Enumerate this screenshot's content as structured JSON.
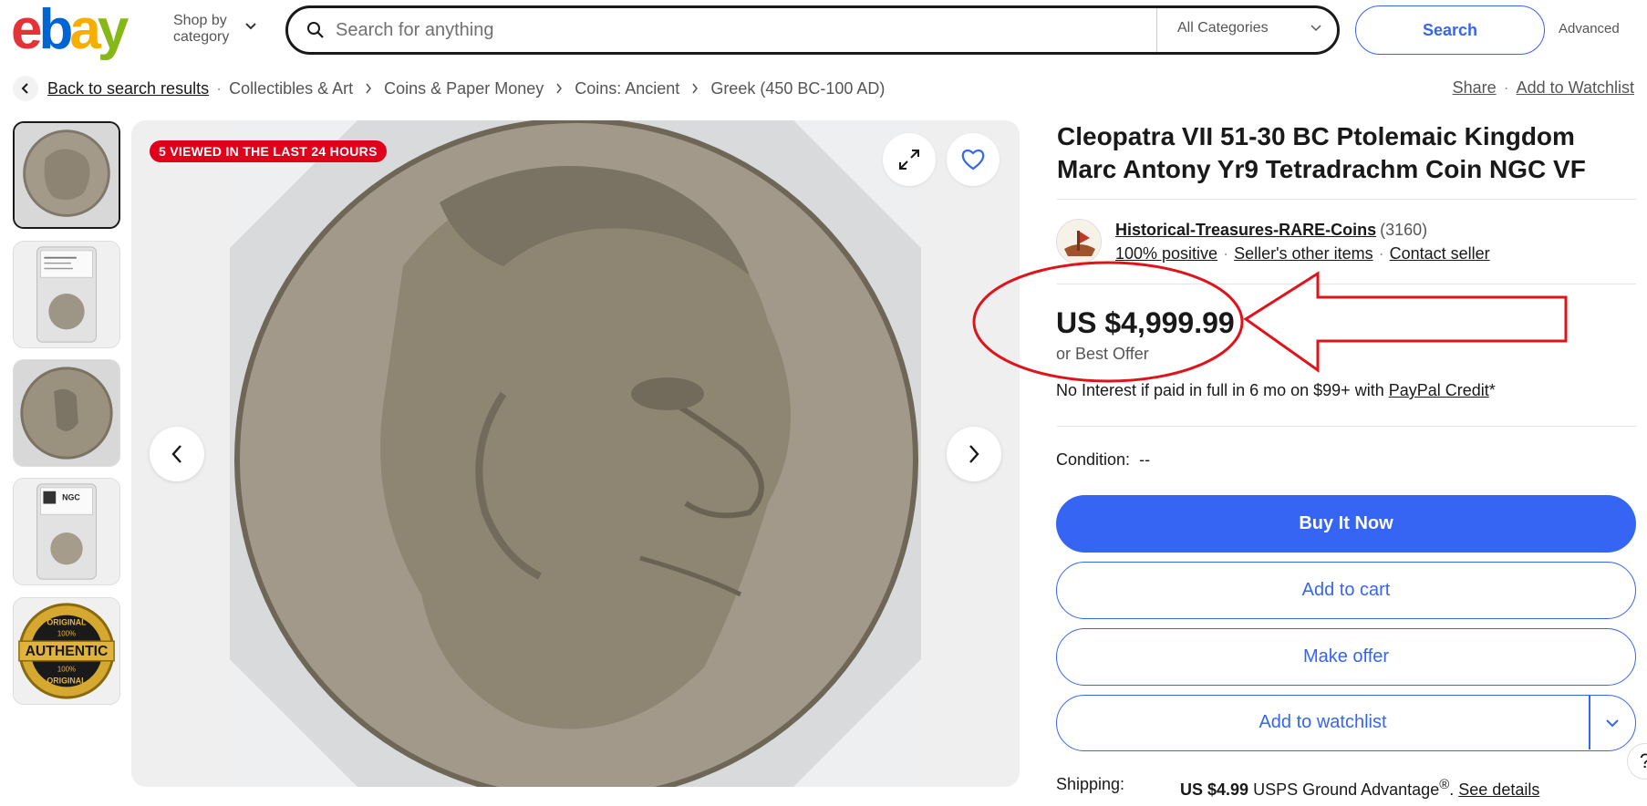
{
  "header": {
    "logo": {
      "e": "e",
      "b": "b",
      "a": "a",
      "y": "y"
    },
    "shop_by_line1": "Shop by",
    "shop_by_line2": "category",
    "search_placeholder": "Search for anything",
    "category": "All Categories",
    "search_button": "Search",
    "advanced": "Advanced"
  },
  "breadcrumb": {
    "back": "Back to search results",
    "items": [
      "Collectibles & Art",
      "Coins & Paper Money",
      "Coins: Ancient",
      "Greek (450 BC-100 AD)"
    ],
    "share": "Share",
    "watchlist": "Add to Watchlist"
  },
  "gallery": {
    "badge": "5 VIEWED IN THE LAST 24 HOURS",
    "thumb_authentic": {
      "top": "ORIGINAL",
      "pct": "100%",
      "main": "AUTHENTIC",
      "pct2": "100%",
      "bottom": "ORIGINAL"
    },
    "thumb_label": "NGC"
  },
  "listing": {
    "title": "Cleopatra VII 51-30 BC Ptolemaic Kingdom Marc Antony Yr9 Tetradrachm Coin NGC VF",
    "seller": {
      "name": "Historical-Treasures-RARE-Coins",
      "feedback": "(3160)",
      "positive": "100% positive",
      "other_items": "Seller's other items",
      "contact": "Contact seller"
    },
    "price": "US $4,999.99",
    "best_offer": "or Best Offer",
    "paypal_text": "No Interest if paid in full in 6 mo on $99+ with ",
    "paypal_link": "PayPal Credit",
    "paypal_star": "*",
    "condition_label": "Condition:",
    "condition_value": "--",
    "buy_now": "Buy It Now",
    "add_to_cart": "Add to cart",
    "make_offer": "Make offer",
    "add_to_watchlist": "Add to watchlist",
    "shipping_label": "Shipping:",
    "shipping_price": "US $4.99",
    "shipping_service": " USPS Ground Advantage",
    "shipping_reg": "®",
    "shipping_dot": ". ",
    "see_details": "See details",
    "help": "?"
  },
  "colors": {
    "accent": "#3665f3",
    "badge": "#e0001c",
    "annotation": "#e0131a"
  },
  "icons": [
    "search-icon",
    "chevron-down-icon",
    "chevron-left-icon",
    "chevron-right-icon",
    "expand-icon",
    "heart-icon"
  ]
}
